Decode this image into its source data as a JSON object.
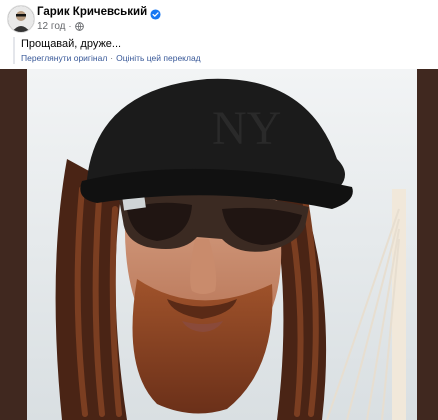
{
  "post": {
    "author": "Гарик Кричевський",
    "time": "12 год",
    "separator": "·",
    "text": "Прощавай, друже...",
    "translation": {
      "see_original": "Переглянути оригінал",
      "separator": "·",
      "rate": "Оцініть цей переклад"
    }
  },
  "icons": {
    "verified": "verified-badge-icon",
    "audience": "globe-icon"
  },
  "colors": {
    "link": "#385898",
    "meta": "#65676b",
    "verified": "#1877f2",
    "photo_border": "#40281f"
  }
}
